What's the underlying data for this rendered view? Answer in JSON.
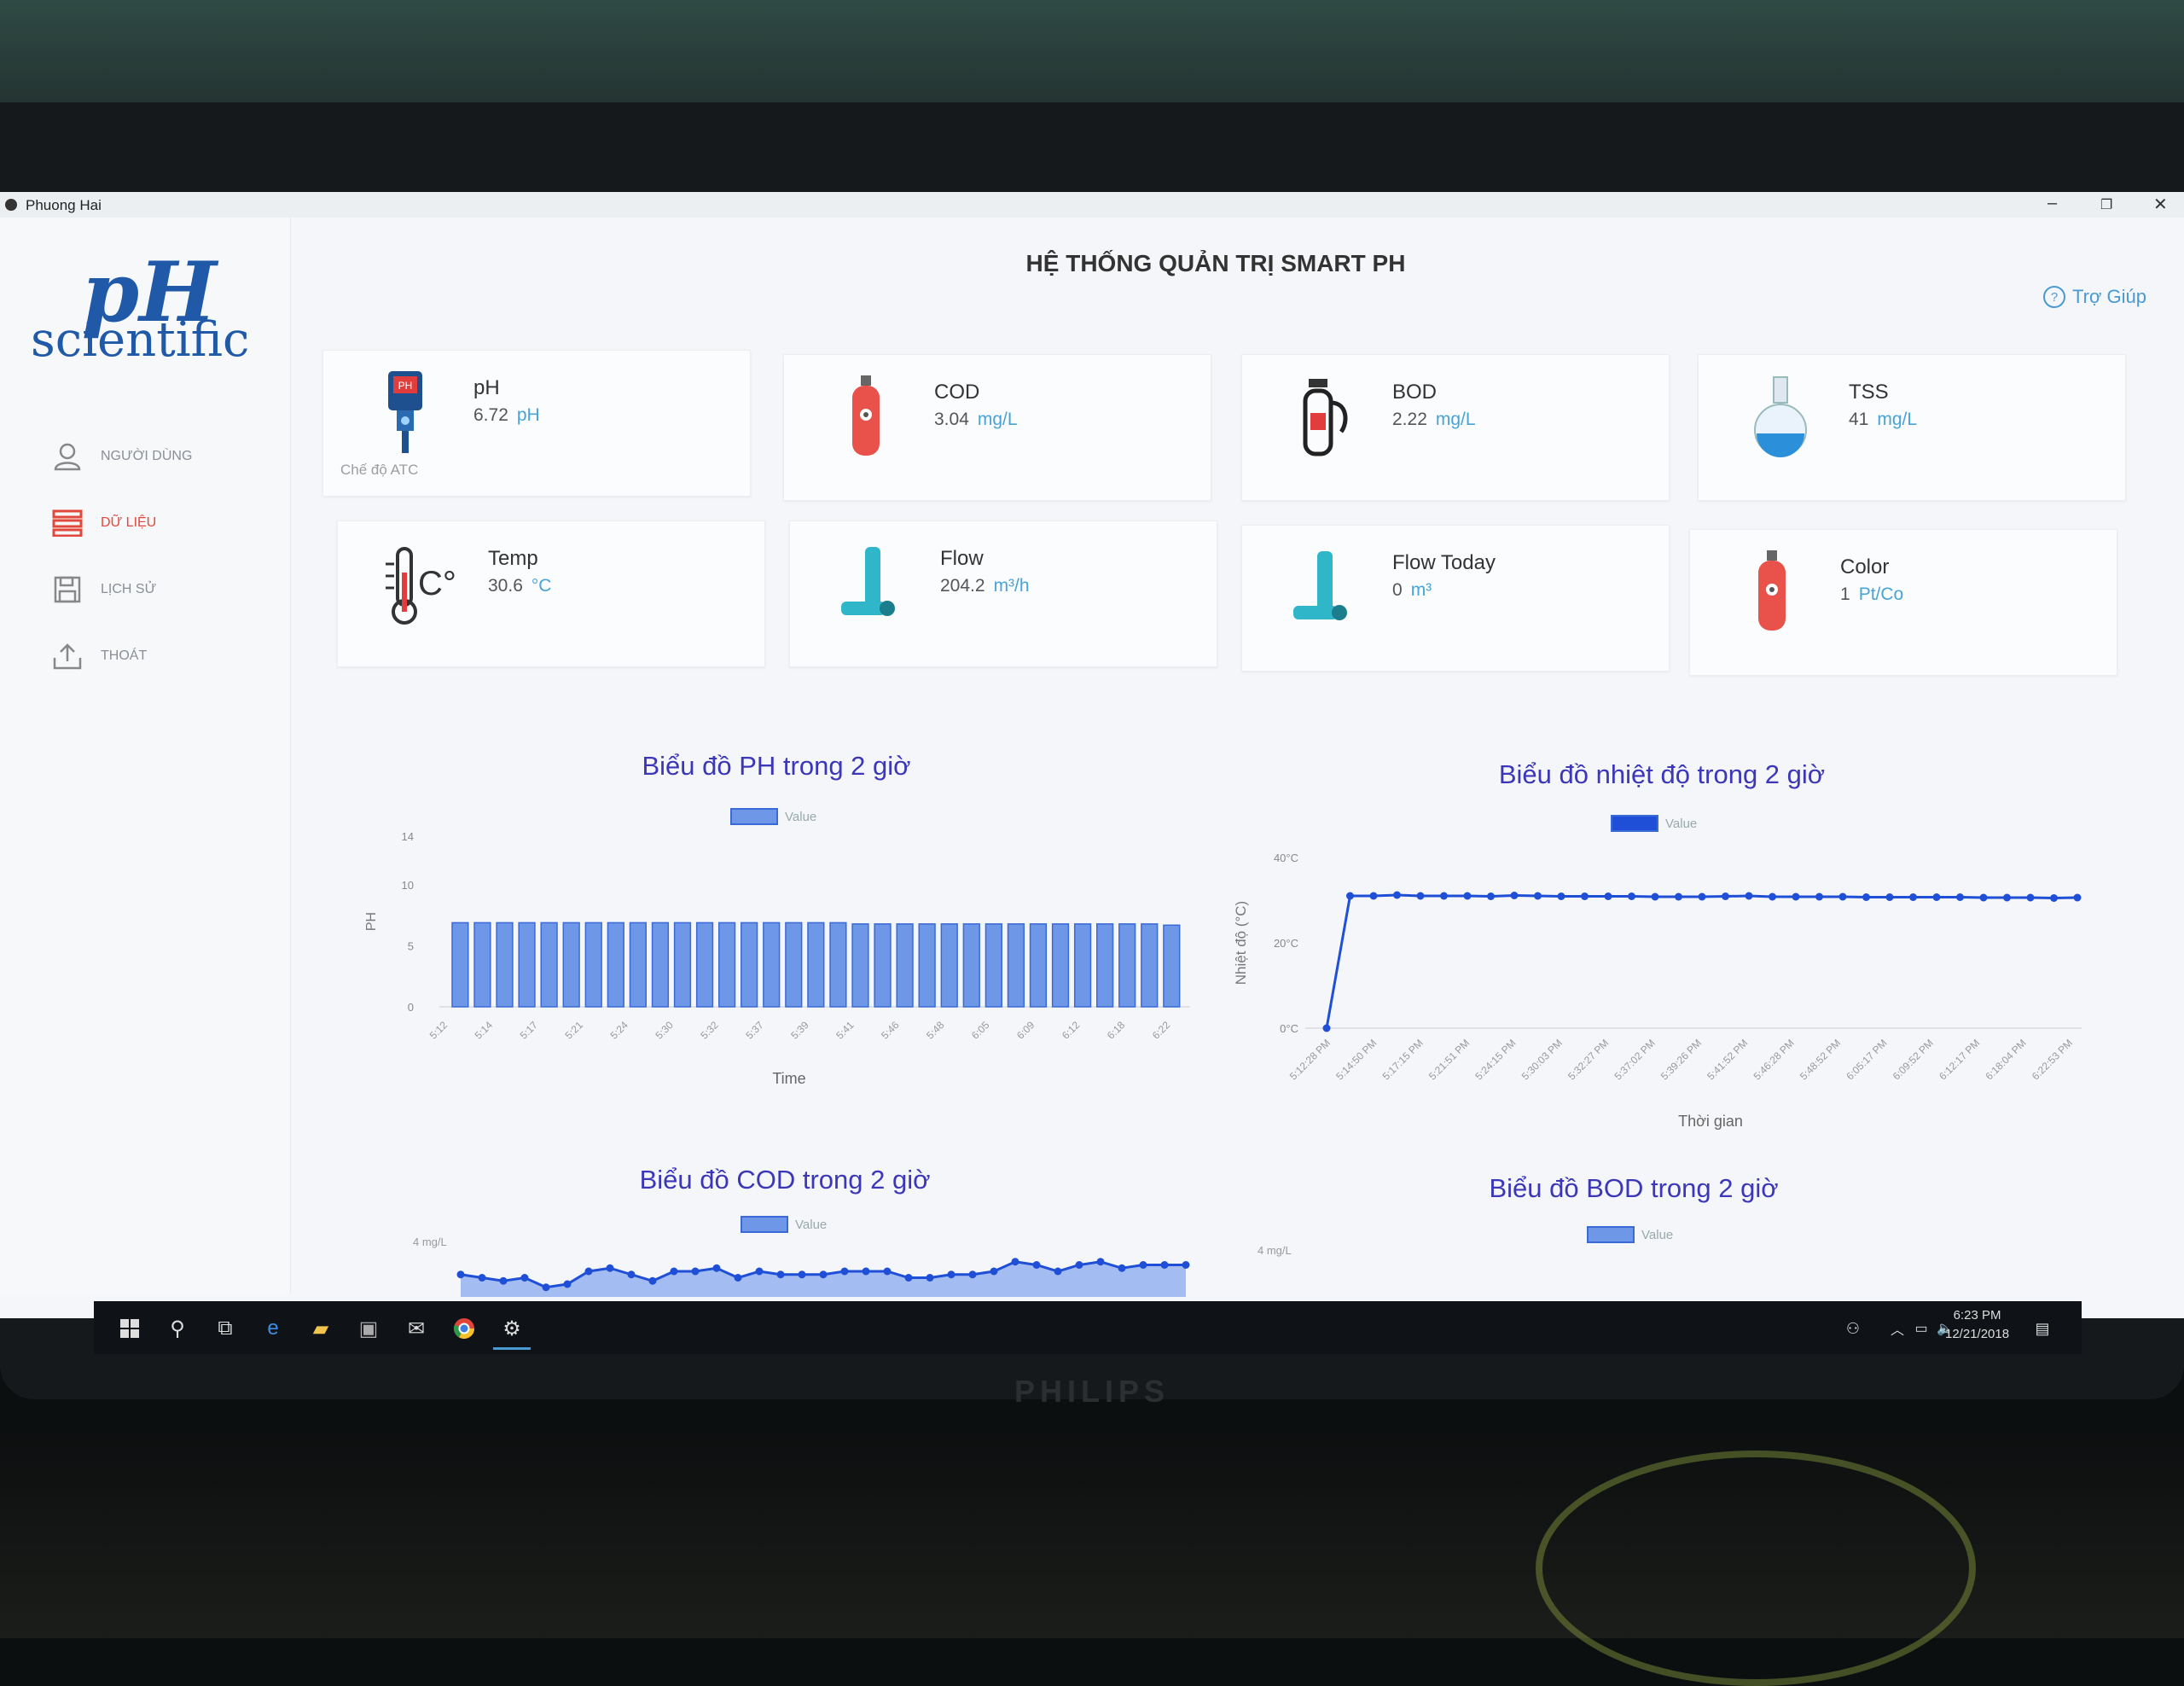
{
  "window": {
    "title": "Phuong Hai"
  },
  "logo": {
    "line1": "pH",
    "line2": "scientific"
  },
  "header": {
    "title": "HỆ THỐNG QUẢN TRỊ SMART PH",
    "help_label": "Trợ Giúp"
  },
  "sidebar": {
    "items": [
      {
        "label": "NGƯỜI DÙNG",
        "icon": "user-icon"
      },
      {
        "label": "DỮ LIỆU",
        "icon": "data-list-icon",
        "active": true
      },
      {
        "label": "LỊCH SỬ",
        "icon": "save-icon"
      },
      {
        "label": "THOÁT",
        "icon": "logout-icon"
      }
    ]
  },
  "cards": [
    {
      "label": "pH",
      "value": "6.72",
      "unit": "pH",
      "note": "Chế độ ATC",
      "icon": "ph-meter-icon"
    },
    {
      "label": "COD",
      "value": "3.04",
      "unit": "mg/L",
      "icon": "gas-cylinder-icon"
    },
    {
      "label": "BOD",
      "value": "2.22",
      "unit": "mg/L",
      "icon": "oxygen-tank-icon"
    },
    {
      "label": "TSS",
      "value": "41",
      "unit": "mg/L",
      "icon": "flask-icon"
    },
    {
      "label": "Temp",
      "value": "30.6",
      "unit": "°C",
      "icon": "thermometer-icon"
    },
    {
      "label": "Flow",
      "value": "204.2",
      "unit": "m³/h",
      "icon": "pipe-icon"
    },
    {
      "label": "Flow Today",
      "value": "0",
      "unit": "m³",
      "icon": "pipe-icon"
    },
    {
      "label": "Color",
      "value": "1",
      "unit": "Pt/Co",
      "icon": "gas-cylinder-icon"
    }
  ],
  "colors": {
    "accent": "#3b37b8",
    "bar": "#6f97e8",
    "line": "#1f4fd6",
    "active": "#e2473b"
  },
  "chart_data": [
    {
      "type": "bar",
      "title": "Biểu đồ PH trong 2 giờ",
      "legend": "Value",
      "xlabel": "Time",
      "ylabel": "PH",
      "ylim": [
        0,
        14
      ],
      "yticks": [
        0,
        5,
        10,
        14
      ],
      "categories": [
        "5:12",
        "5:14",
        "5:17",
        "5:21",
        "5:24",
        "5:30",
        "5:32",
        "5:37",
        "5:39",
        "5:41",
        "5:46",
        "5:48",
        "6:05",
        "6:09",
        "6:12",
        "6:18",
        "6:22"
      ],
      "values": [
        6.9,
        6.9,
        6.9,
        6.9,
        6.9,
        6.9,
        6.9,
        6.9,
        6.9,
        6.9,
        6.9,
        6.9,
        6.9,
        6.9,
        6.9,
        6.9,
        6.9,
        6.9,
        6.8,
        6.8,
        6.8,
        6.8,
        6.8,
        6.8,
        6.8,
        6.8,
        6.8,
        6.8,
        6.8,
        6.8,
        6.8,
        6.8,
        6.7
      ]
    },
    {
      "type": "line",
      "title": "Biểu đồ nhiệt độ trong 2 giờ",
      "legend": "Value",
      "xlabel": "Thời gian",
      "ylabel": "Nhiệt độ (°C)",
      "ylim": [
        0,
        40
      ],
      "yticks": [
        "0°C",
        "20°C",
        "40°C"
      ],
      "categories": [
        "5:12:28 PM",
        "5:14:50 PM",
        "5:17:15 PM",
        "5:21:51 PM",
        "5:24:15 PM",
        "5:30:03 PM",
        "5:32:27 PM",
        "5:37:02 PM",
        "5:39:26 PM",
        "5:41:52 PM",
        "5:46:28 PM",
        "5:48:52 PM",
        "6:05:17 PM",
        "6:09:52 PM",
        "6:12:17 PM",
        "6:18:04 PM",
        "6:22:53 PM"
      ],
      "values": [
        0,
        31,
        31,
        31.2,
        31,
        31,
        31,
        30.9,
        31.1,
        31,
        30.9,
        30.9,
        30.9,
        30.9,
        30.8,
        30.8,
        30.8,
        30.9,
        31,
        30.8,
        30.8,
        30.8,
        30.8,
        30.7,
        30.7,
        30.7,
        30.7,
        30.7,
        30.6,
        30.6,
        30.6,
        30.5,
        30.6
      ]
    },
    {
      "type": "area",
      "title": "Biểu đồ COD trong 2 giờ",
      "legend": "Value",
      "ytick_top": "4 mg/L",
      "values": [
        3.1,
        3.0,
        2.9,
        3.0,
        2.7,
        2.8,
        3.2,
        3.3,
        3.1,
        2.9,
        3.2,
        3.2,
        3.3,
        3.0,
        3.2,
        3.1,
        3.1,
        3.1,
        3.2,
        3.2,
        3.2,
        3.0,
        3.0,
        3.1,
        3.1,
        3.2,
        3.5,
        3.4,
        3.2,
        3.4,
        3.5,
        3.3,
        3.4,
        3.4,
        3.4
      ]
    },
    {
      "type": "area",
      "title": "Biểu đồ BOD trong 2 giờ",
      "legend": "Value",
      "ytick_top": "4 mg/L",
      "values": []
    }
  ],
  "taskbar": {
    "time": "6:23 PM",
    "date": "12/21/2018"
  },
  "monitor": {
    "brand": "PHILIPS"
  }
}
